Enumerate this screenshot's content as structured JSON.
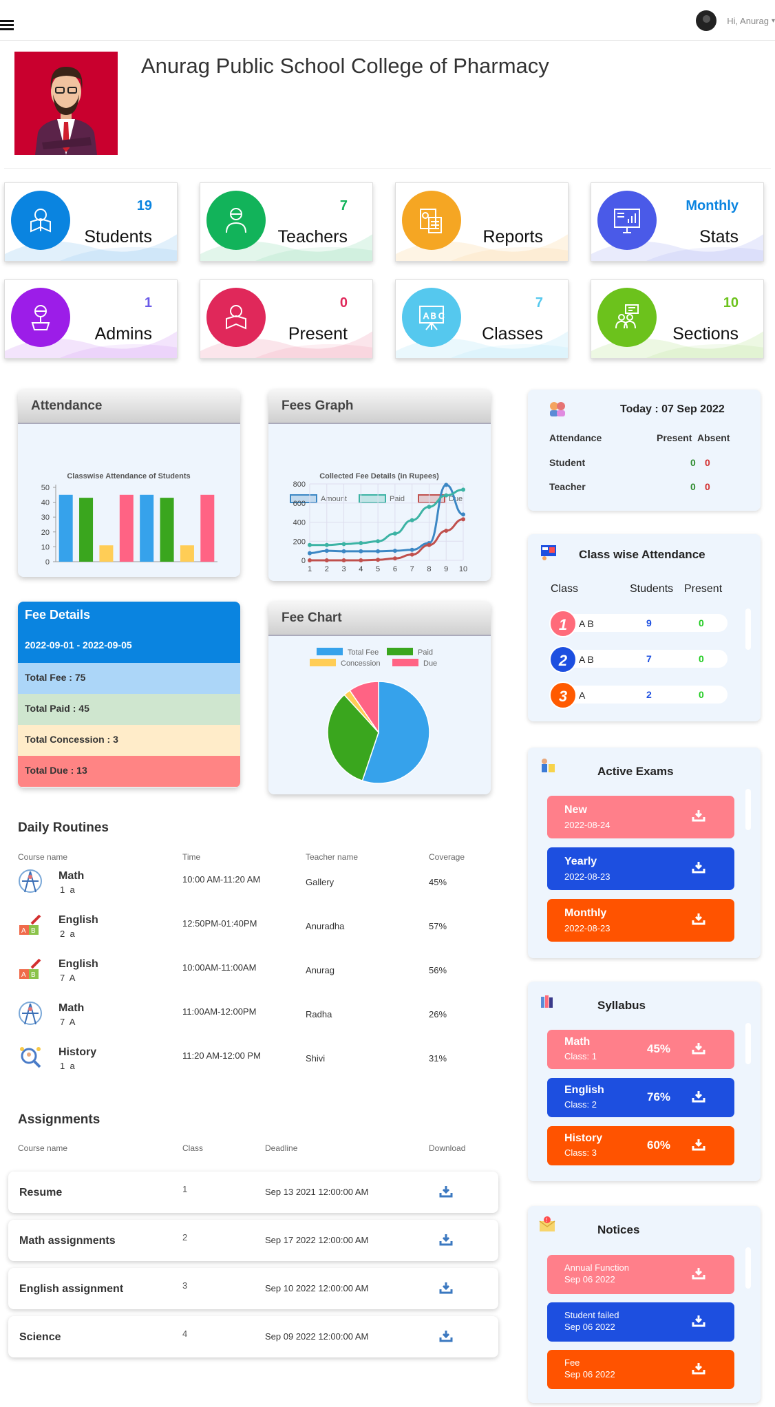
{
  "header": {
    "greeting": "Hi, Anurag"
  },
  "school_name": "Anurag Public School College of Pharmacy",
  "cards": [
    {
      "label": "Students",
      "value": "19",
      "color": "#0a84e0",
      "numcolor": "#0a84e0",
      "icon": "student-reading-icon"
    },
    {
      "label": "Teachers",
      "value": "7",
      "color": "#12b35a",
      "numcolor": "#12b35a",
      "icon": "teacher-icon"
    },
    {
      "label": "Reports",
      "value": "",
      "color": "#f5a623",
      "numcolor": "#f5a623",
      "icon": "report-calculator-icon"
    },
    {
      "label": "Stats",
      "value": "Monthly",
      "color": "#4a5ae8",
      "numcolor": "#0a84e0",
      "icon": "monitor-chart-icon"
    },
    {
      "label": "Admins",
      "value": "1",
      "color": "#9c1de8",
      "numcolor": "#6a5ae8",
      "icon": "admin-podium-icon"
    },
    {
      "label": "Present",
      "value": "0",
      "color": "#e0285a",
      "numcolor": "#e0285a",
      "icon": "student-present-icon"
    },
    {
      "label": "Classes",
      "value": "7",
      "color": "#55c8ee",
      "numcolor": "#55c8ee",
      "icon": "whiteboard-abc-icon"
    },
    {
      "label": "Sections",
      "value": "10",
      "color": "#6cc21c",
      "numcolor": "#6cc21c",
      "icon": "group-sections-icon"
    }
  ],
  "attendance_panel": {
    "title": "Attendance"
  },
  "fees_panel": {
    "title": "Fees Graph"
  },
  "fee_chart_panel": {
    "title": "Fee Chart"
  },
  "chart_data": [
    {
      "type": "bar",
      "title": "Classwise Attendance of Students",
      "ylim": [
        0,
        50
      ],
      "yticks": [
        0,
        10,
        20,
        30,
        40,
        50
      ],
      "values": [
        45,
        43,
        11,
        45,
        45,
        43,
        11,
        45
      ],
      "colors": [
        "#36a2eb",
        "#3aa61e",
        "#ffcd56",
        "#ff6384",
        "#36a2eb",
        "#3aa61e",
        "#ffcd56",
        "#ff6384"
      ]
    },
    {
      "type": "line",
      "title": "Collected Fee Details (in Rupees)",
      "x": [
        1,
        2,
        3,
        4,
        5,
        6,
        7,
        8,
        9,
        10
      ],
      "ylim": [
        0,
        800
      ],
      "yticks": [
        0,
        200,
        400,
        600,
        800
      ],
      "series": [
        {
          "name": "Amount",
          "color": "#3b87c4",
          "values": [
            75,
            100,
            95,
            95,
            95,
            100,
            110,
            180,
            790,
            480
          ]
        },
        {
          "name": "Paid",
          "color": "#3cb3a4",
          "values": [
            160,
            160,
            170,
            180,
            200,
            280,
            420,
            560,
            680,
            740
          ]
        },
        {
          "name": "Due",
          "color": "#c0504d",
          "values": [
            0,
            0,
            0,
            0,
            5,
            20,
            60,
            160,
            310,
            430
          ]
        }
      ]
    },
    {
      "type": "pie",
      "legend": [
        "Total Fee",
        "Paid",
        "Concession",
        "Due"
      ],
      "values": [
        75,
        45,
        3,
        13
      ],
      "colors": [
        "#36a2eb",
        "#3aa61e",
        "#ffcd56",
        "#ff6384"
      ]
    }
  ],
  "fee_details": {
    "title": "Fee Details",
    "dates": "2022-09-01 - 2022-09-05",
    "rows": [
      {
        "text": "Total Fee : 75",
        "bg": "#acd6f8"
      },
      {
        "text": "Total Paid : 45",
        "bg": "#cfe6cf"
      },
      {
        "text": "Total Concession : 3",
        "bg": "#ffecc9"
      },
      {
        "text": "Total Due : 13",
        "bg": "#ff8484"
      }
    ]
  },
  "routines": {
    "title": "Daily Routines",
    "headers": [
      "Course name",
      "Time",
      "Teacher name",
      "Coverage"
    ],
    "rows": [
      {
        "course": "Math",
        "class": "1  a",
        "time": "10:00 AM-11:20 AM",
        "teacher": "Gallery",
        "coverage": "45%"
      },
      {
        "course": "English",
        "class": "2  a",
        "time": "12:50PM-01:40PM",
        "teacher": "Anuradha",
        "coverage": "57%"
      },
      {
        "course": "English",
        "class": "7  A",
        "time": "10:00AM-11:00AM",
        "teacher": "Anurag",
        "coverage": "56%"
      },
      {
        "course": "Math",
        "class": "7  A",
        "time": "11:00AM-12:00PM",
        "teacher": "Radha",
        "coverage": "26%"
      },
      {
        "course": "History",
        "class": "1  a",
        "time": "11:20 AM-12:00 PM",
        "teacher": "Shivi",
        "coverage": "31%"
      }
    ]
  },
  "assignments": {
    "title": "Assignments",
    "headers": [
      "Course name",
      "Class",
      "Deadline",
      "Download"
    ],
    "rows": [
      {
        "name": "Resume",
        "class": "1",
        "deadline": "Sep 13 2021 12:00:00 AM"
      },
      {
        "name": "Math assignments",
        "class": "2",
        "deadline": "Sep 17 2022 12:00:00 AM"
      },
      {
        "name": "English assignment",
        "class": "3",
        "deadline": "Sep 10 2022 12:00:00 AM"
      },
      {
        "name": "Science",
        "class": "4",
        "deadline": "Sep 09 2022 12:00:00 AM"
      }
    ]
  },
  "today": {
    "title": "Today : 07 Sep 2022",
    "h1": "Attendance",
    "h2": "Present",
    "h3": "Absent",
    "rows": [
      {
        "label": "Student",
        "present": "0",
        "absent": "0"
      },
      {
        "label": "Teacher",
        "present": "0",
        "absent": "0"
      }
    ]
  },
  "classwise": {
    "title": "Class wise Attendance",
    "h1": "Class",
    "h2": "Students",
    "h3": "Present",
    "rows": [
      {
        "n": "1",
        "cls": "A B",
        "students": "9",
        "present": "0",
        "color": "#ff6b7a"
      },
      {
        "n": "2",
        "cls": "A B",
        "students": "7",
        "present": "0",
        "color": "#1d4fe0"
      },
      {
        "n": "3",
        "cls": "A",
        "students": "2",
        "present": "0",
        "color": "#ff5a00"
      }
    ]
  },
  "exams": {
    "title": "Active Exams",
    "items": [
      {
        "name": "New",
        "date": "2022-08-24",
        "color": "#ff7f8a"
      },
      {
        "name": "Yearly",
        "date": "2022-08-23",
        "color": "#1d4fe0"
      },
      {
        "name": "Monthly",
        "date": "2022-08-23",
        "color": "#ff5300"
      }
    ]
  },
  "syllabus": {
    "title": "Syllabus",
    "items": [
      {
        "name": "Math",
        "cls": "Class: 1",
        "pct": "45%",
        "color": "#ff7f8a"
      },
      {
        "name": "English",
        "cls": "Class: 2",
        "pct": "76%",
        "color": "#1d4fe0"
      },
      {
        "name": "History",
        "cls": "Class: 3",
        "pct": "60%",
        "color": "#ff5300"
      }
    ]
  },
  "notices": {
    "title": "Notices",
    "items": [
      {
        "name": "Annual Function",
        "date": "Sep 06 2022",
        "color": "#ff7f8a"
      },
      {
        "name": "Student failed",
        "date": "Sep 06 2022",
        "color": "#1d4fe0"
      },
      {
        "name": "Fee",
        "date": "Sep 06 2022",
        "color": "#ff5300"
      }
    ]
  }
}
